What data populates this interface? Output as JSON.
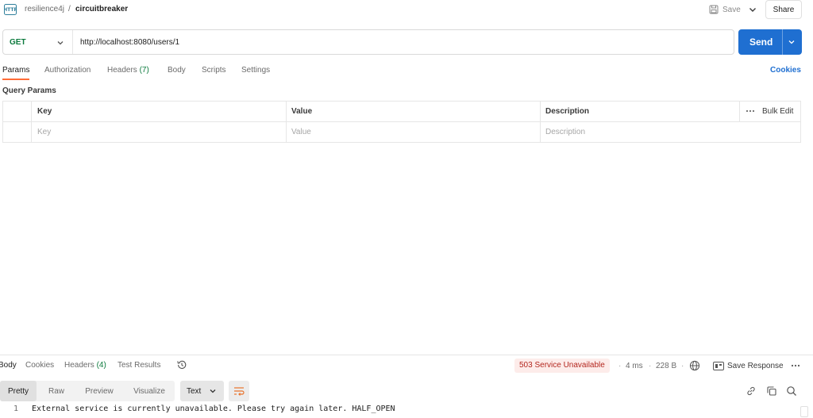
{
  "header": {
    "workspace": "resilience4j",
    "separator": "/",
    "request_name": "circuitbreaker",
    "save_label": "Save",
    "share_label": "Share"
  },
  "request": {
    "method": "GET",
    "url": "http://localhost:8080/users/1",
    "send_label": "Send",
    "method_color": "#0c7a3d",
    "send_color": "#1f6fd1"
  },
  "request_tabs": {
    "params": "Params",
    "authorization": "Authorization",
    "headers": "Headers",
    "headers_count": "(7)",
    "body": "Body",
    "scripts": "Scripts",
    "settings": "Settings",
    "cookies": "Cookies",
    "active_underline_color": "#ff6c37"
  },
  "query_params": {
    "title": "Query Params",
    "columns": [
      "Key",
      "Value",
      "Description"
    ],
    "bulk_edit": "Bulk Edit",
    "placeholders": [
      "Key",
      "Value",
      "Description"
    ]
  },
  "response": {
    "tabs": {
      "body": "Body",
      "cookies": "Cookies",
      "headers": "Headers",
      "headers_count": "(4)",
      "test_results": "Test Results"
    },
    "status": "503 Service Unavailable",
    "status_color": "#b3261e",
    "time": "4 ms",
    "size": "228 B",
    "dot": "·",
    "save_response": "Save Response",
    "formats": [
      "Pretty",
      "Raw",
      "Preview",
      "Visualize"
    ],
    "format_selected": "Text",
    "lines": [
      {
        "number": "1",
        "text": "External service is currently unavailable. Please try again later. HALF_OPEN"
      }
    ]
  },
  "icons": [
    "http-icon",
    "save-icon",
    "chevron-down-icon",
    "more-icon",
    "history-icon",
    "globe-icon",
    "save-response-icon",
    "wrap-lines-icon",
    "link-icon",
    "copy-icon",
    "search-icon"
  ]
}
